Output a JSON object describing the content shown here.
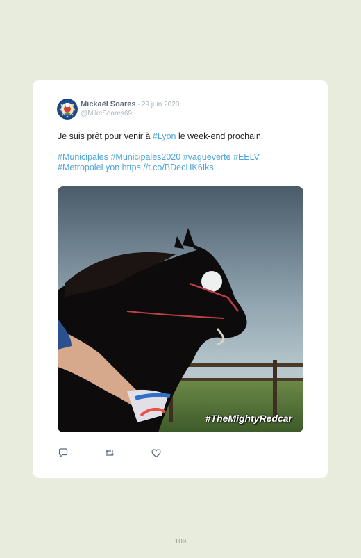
{
  "tweet": {
    "author_name": "Mickaël Soares",
    "separator": " - ",
    "date": "29 juin 2020",
    "handle": "@MikeSoares69",
    "text_before_link": "Je suis prêt pour venir à ",
    "mention_link": "#Lyon",
    "text_after_link": " le week-end prochain.",
    "hashtags": [
      "#Municipales",
      "#Municipales2020",
      "#vagueverte",
      "#EELV",
      "#MetropoleLyon"
    ],
    "url": "https://t.co/BDecHK6Iks",
    "media_caption": "#TheMightyRedcar"
  },
  "actions": {
    "reply_icon": "reply-icon",
    "retweet_icon": "retweet-icon",
    "like_icon": "heart-icon"
  },
  "page_number": "109",
  "colors": {
    "background": "#e7ecdc",
    "card": "#ffffff",
    "link": "#4ea4d9",
    "name": "#5b6b7c",
    "muted": "#a8b4bf"
  }
}
